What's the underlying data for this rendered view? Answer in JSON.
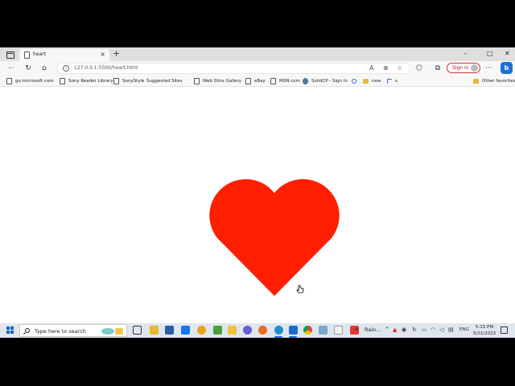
{
  "browser": {
    "tab": {
      "title": "heart",
      "close": "×"
    },
    "new_tab": "+",
    "window_controls": {
      "minimize": "–",
      "maximize": "□",
      "close": "✕"
    },
    "nav": {
      "back": "←",
      "refresh": "↻",
      "home": "⌂"
    },
    "url": "127.0.0.1:5500/heart.html",
    "signin_label": "Sign in",
    "more": "···",
    "bing": "b"
  },
  "favorites": {
    "items": [
      {
        "label": "go.microsoft.com",
        "icon": "page"
      },
      {
        "label": "Sony Reader Library",
        "icon": "page"
      },
      {
        "label": "SonyStyle",
        "icon": "page"
      },
      {
        "label": "Suggested Sites",
        "icon": "bing"
      },
      {
        "label": "Web Slice Gallery",
        "icon": "page"
      },
      {
        "label": "eBay",
        "icon": "page"
      },
      {
        "label": "MSN.com",
        "icon": "page"
      },
      {
        "label": "SolidCP - Sign In",
        "icon": "solid"
      },
      {
        "label": "",
        "icon": "mag"
      },
      {
        "label": "new",
        "icon": "folder"
      },
      {
        "label": "s",
        "icon": "flag"
      }
    ],
    "other": "Other favorites"
  },
  "content": {
    "heart_color": "#ff1e00"
  },
  "taskbar": {
    "search_placeholder": "Type here to search",
    "weather": "Rain...",
    "lang": "ENG",
    "time": "5:15 PM",
    "date": "5/21/2023"
  }
}
